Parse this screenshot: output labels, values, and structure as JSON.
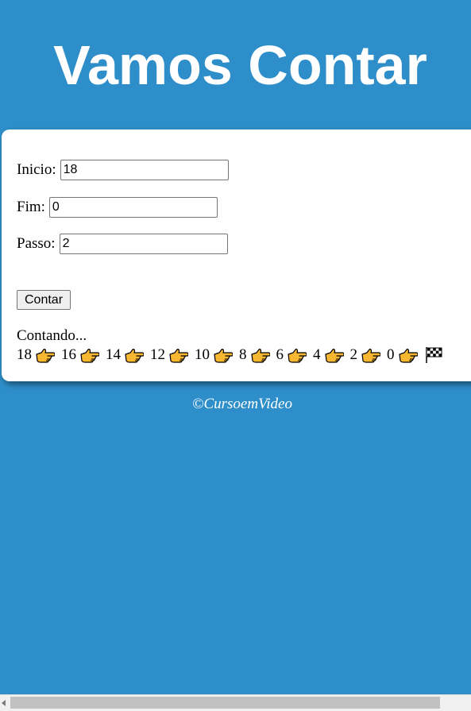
{
  "header": {
    "title": "Vamos Contar"
  },
  "form": {
    "inicio_label": "Inicio:",
    "inicio_value": "18",
    "fim_label": "Fim:",
    "fim_value": "0",
    "passo_label": "Passo:",
    "passo_value": "2",
    "button_label": "Contar"
  },
  "result": {
    "status": "Contando...",
    "numbers": [
      "18",
      "16",
      "14",
      "12",
      "10",
      "8",
      "6",
      "4",
      "2",
      "0"
    ],
    "separator_icon": "pointing-hand-icon",
    "end_icon": "checkered-flag-icon"
  },
  "footer": {
    "text": "©CursoemVideo"
  },
  "colors": {
    "background": "#2e8ec9",
    "card": "#ffffff",
    "hand": "#f7b731"
  }
}
